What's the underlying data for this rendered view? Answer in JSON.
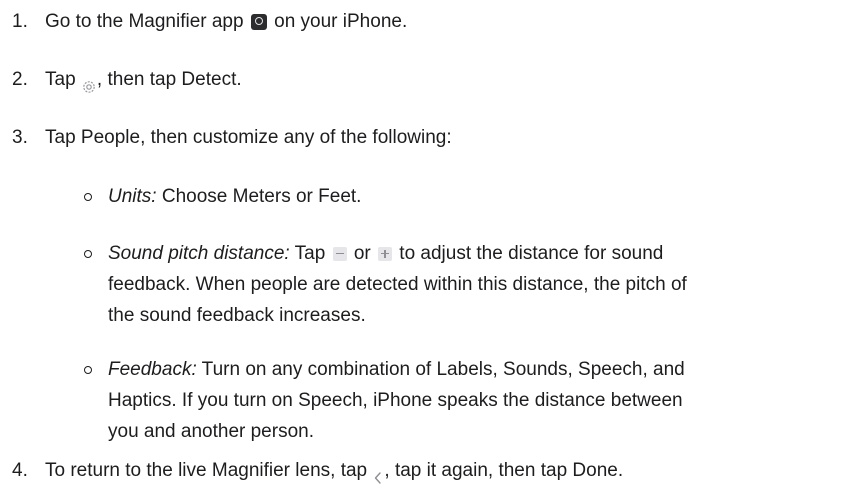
{
  "steps": [
    {
      "number": "1.",
      "text_before": "Go to the Magnifier app",
      "icon": "magnifier-app-icon",
      "text_after": "on your iPhone."
    },
    {
      "number": "2.",
      "text_before": "Tap",
      "icon": "gear-icon",
      "text_after": ", then tap Detect."
    },
    {
      "number": "3.",
      "text": "Tap People, then customize any of the following:",
      "options": [
        {
          "term": "Units:",
          "lines": [
            "Choose Meters or Feet."
          ]
        },
        {
          "term": "Sound pitch distance:",
          "first_line_a": "Tap",
          "first_line_b": "or",
          "first_line_c": "to adjust the distance for sound",
          "icons": [
            "minus-icon",
            "plus-icon"
          ],
          "more_lines": [
            "feedback. When people are detected within this distance, the pitch of",
            "the sound feedback increases."
          ]
        },
        {
          "term": "Feedback:",
          "first_line": "Turn on any combination of Labels, Sounds, Speech, and",
          "more_lines": [
            "Haptics. If you turn on Speech, iPhone speaks the distance between",
            "you and another person."
          ]
        }
      ]
    },
    {
      "number": "4.",
      "text_before": "To return to the live Magnifier lens, tap",
      "icon": "back-chevron-icon",
      "text_after": ", tap it again, then tap Done."
    }
  ]
}
